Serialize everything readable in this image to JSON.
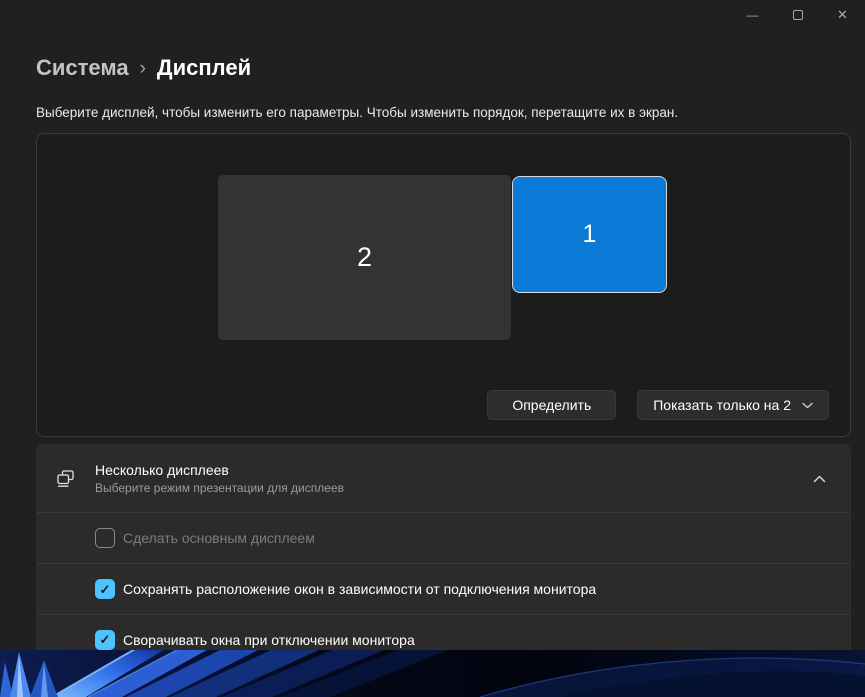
{
  "icons": {
    "breadcrumb_separator": "›",
    "checkmark": "✓",
    "close": "✕",
    "minimize": "—",
    "maximize": "square-outline",
    "chevron_up": "chevron-up",
    "chevron_down": "chevron-down",
    "multiple_displays": "overlapping-monitors"
  },
  "breadcrumb": {
    "parent": "Система",
    "current": "Дисплей"
  },
  "description": "Выберите дисплей, чтобы изменить его параметры. Чтобы изменить порядок, перетащите их в экран.",
  "display_panel": {
    "monitors": [
      {
        "id": "2"
      },
      {
        "id": "1"
      }
    ],
    "identify_label": "Определить",
    "show_only_label": "Показать только на 2"
  },
  "multiple_displays": {
    "title": "Несколько дисплеев",
    "subtitle": "Выберите режим презентации для дисплеев",
    "options": [
      {
        "label": "Сделать основным дисплеем",
        "checked": false,
        "disabled": true
      },
      {
        "label": "Сохранять расположение окон в зависимости от подключения монитора",
        "checked": true,
        "disabled": false
      },
      {
        "label": "Сворачивать окна при отключении монитора",
        "checked": true,
        "disabled": false
      }
    ]
  },
  "colors": {
    "selected_monitor": "#0b79d6",
    "checkbox_accent": "#4cc2ff",
    "page_background": "#202020"
  }
}
